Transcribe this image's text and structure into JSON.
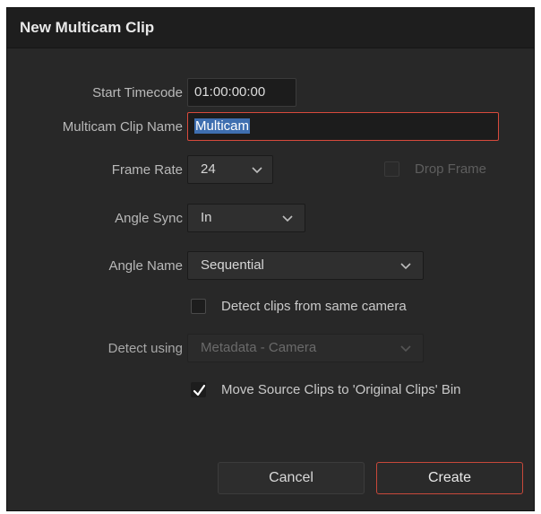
{
  "dialog": {
    "title": "New Multicam Clip"
  },
  "fields": {
    "start_timecode": {
      "label": "Start Timecode",
      "value": "01:00:00:00"
    },
    "clip_name": {
      "label": "Multicam Clip Name",
      "value": "Multicam"
    },
    "frame_rate": {
      "label": "Frame Rate",
      "value": "24"
    },
    "drop_frame": {
      "label": "Drop Frame",
      "checked": false,
      "enabled": false
    },
    "angle_sync": {
      "label": "Angle Sync",
      "value": "In"
    },
    "angle_name": {
      "label": "Angle Name",
      "value": "Sequential"
    },
    "detect_same_camera": {
      "label": "Detect clips from same camera",
      "checked": false
    },
    "detect_using": {
      "label": "Detect using",
      "value": "Metadata - Camera",
      "enabled": false
    },
    "move_source": {
      "label": "Move Source Clips to 'Original Clips' Bin",
      "checked": true
    }
  },
  "buttons": {
    "cancel": "Cancel",
    "create": "Create"
  },
  "icons": {
    "dropdown": "chevron-down-icon",
    "check": "checkmark-icon"
  },
  "colors": {
    "focus_accent": "#d84a3c",
    "selection": "#3f6fb0",
    "dialog_bg": "#282828"
  }
}
